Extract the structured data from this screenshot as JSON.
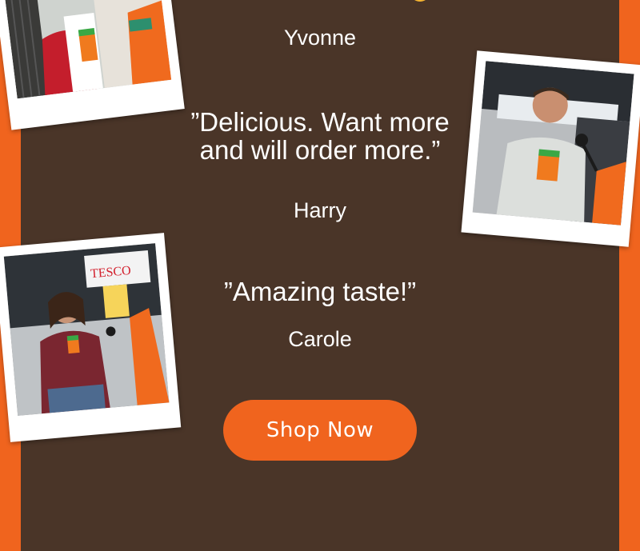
{
  "testimonials": [
    {
      "name": "Yvonne"
    },
    {
      "quote_line1": "”Delicious. Want more",
      "quote_line2": "and will order more.”",
      "name": "Harry"
    },
    {
      "quote_line1": "”Amazing taste!”",
      "name": "Carole"
    }
  ],
  "photos": {
    "store_sign_text": "TESCO"
  },
  "cta": {
    "label": "Shop Now"
  },
  "colors": {
    "background": "#4a3528",
    "accent": "#f0641e",
    "text": "#ffffff",
    "card": "#ffffff"
  }
}
